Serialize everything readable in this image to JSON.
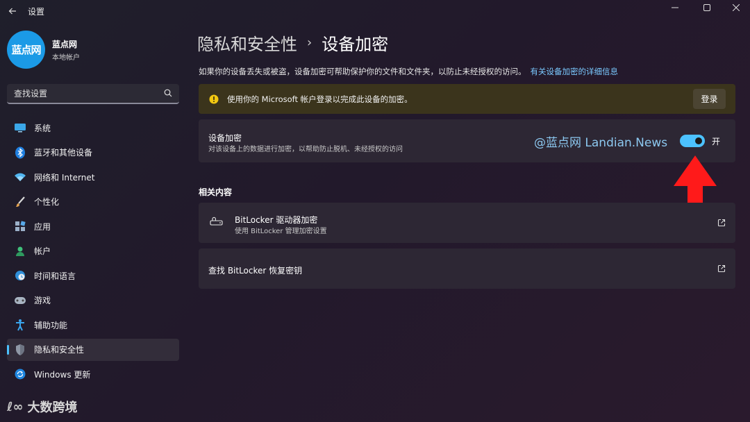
{
  "window": {
    "title": "设置"
  },
  "profile": {
    "avatar_text": "蓝点网",
    "name": "蓝点网",
    "account_type": "本地帐户"
  },
  "search": {
    "placeholder": "查找设置"
  },
  "nav": {
    "items": [
      {
        "label": "系统",
        "icon": "monitor-icon"
      },
      {
        "label": "蓝牙和其他设备",
        "icon": "bluetooth-icon"
      },
      {
        "label": "网络和 Internet",
        "icon": "wifi-icon"
      },
      {
        "label": "个性化",
        "icon": "brush-icon"
      },
      {
        "label": "应用",
        "icon": "apps-icon"
      },
      {
        "label": "帐户",
        "icon": "person-icon"
      },
      {
        "label": "时间和语言",
        "icon": "globe-clock-icon"
      },
      {
        "label": "游戏",
        "icon": "gamepad-icon"
      },
      {
        "label": "辅助功能",
        "icon": "accessibility-icon"
      },
      {
        "label": "隐私和安全性",
        "icon": "shield-icon",
        "active": true
      },
      {
        "label": "Windows 更新",
        "icon": "sync-icon"
      }
    ]
  },
  "bottom_watermark": {
    "logo": "ℓ∞",
    "text": "大数跨境"
  },
  "breadcrumb": {
    "parent": "隐私和安全性",
    "separator": "›",
    "current": "设备加密"
  },
  "description": {
    "text": "如果你的设备丢失或被盗，设备加密可帮助保护你的文件和文件夹，以防止未经授权的访问。",
    "link": "有关设备加密的详细信息"
  },
  "banner": {
    "text": "使用你的 Microsoft 帐户登录以完成此设备的加密。",
    "button": "登录",
    "color": "#3b341c"
  },
  "encryption": {
    "title": "设备加密",
    "subtitle": "对该设备上的数据进行加密，以帮助防止脱机、未经授权的访问",
    "watermark": "@蓝点网 Landian.News",
    "toggle_state": "开",
    "enabled": true,
    "accent_color": "#4cc2ff"
  },
  "related": {
    "title": "相关内容",
    "bitlocker_title": "BitLocker 驱动器加密",
    "bitlocker_subtitle": "使用 BitLocker 管理加密设置",
    "recovery_title": "查找 BitLocker 恢复密钥"
  },
  "annotation": {
    "arrow_color": "#ff1a1a"
  }
}
